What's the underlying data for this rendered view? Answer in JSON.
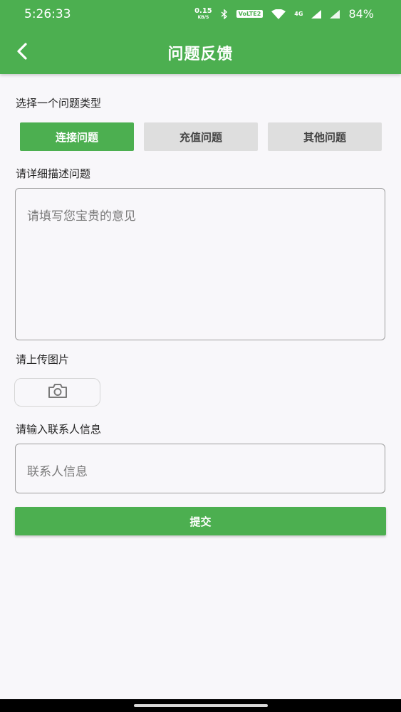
{
  "status_bar": {
    "time": "5:26:33",
    "net_speed": "0.15",
    "net_unit": "KB/S",
    "volte": "VoLTE2",
    "network_gen": "4G",
    "battery": "84%"
  },
  "app_bar": {
    "title": "问题反馈",
    "back_icon": "chevron-left-icon"
  },
  "form": {
    "type_label": "选择一个问题类型",
    "types": [
      {
        "label": "连接问题",
        "selected": true
      },
      {
        "label": "充值问题",
        "selected": false
      },
      {
        "label": "其他问题",
        "selected": false
      }
    ],
    "description_label": "请详细描述问题",
    "description_placeholder": "请填写您宝贵的意见",
    "upload_label": "请上传图片",
    "upload_icon": "camera-icon",
    "contact_label": "请输入联系人信息",
    "contact_placeholder": "联系人信息",
    "submit_label": "提交"
  },
  "colors": {
    "primary": "#4caf50",
    "inactive_button": "#dedede",
    "background": "#f8f7fa"
  }
}
